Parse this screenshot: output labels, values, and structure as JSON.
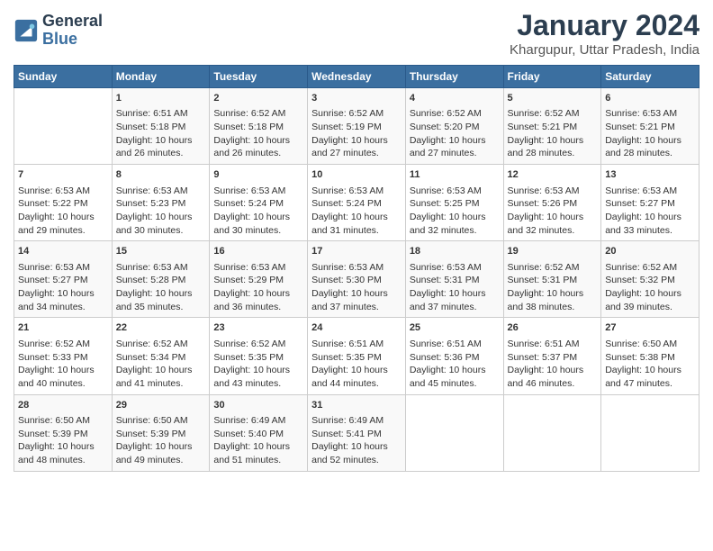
{
  "header": {
    "logo_line1": "General",
    "logo_line2": "Blue",
    "main_title": "January 2024",
    "subtitle": "Khargupur, Uttar Pradesh, India"
  },
  "days_of_week": [
    "Sunday",
    "Monday",
    "Tuesday",
    "Wednesday",
    "Thursday",
    "Friday",
    "Saturday"
  ],
  "weeks": [
    [
      {
        "day": "",
        "info": ""
      },
      {
        "day": "1",
        "info": "Sunrise: 6:51 AM\nSunset: 5:18 PM\nDaylight: 10 hours\nand 26 minutes."
      },
      {
        "day": "2",
        "info": "Sunrise: 6:52 AM\nSunset: 5:18 PM\nDaylight: 10 hours\nand 26 minutes."
      },
      {
        "day": "3",
        "info": "Sunrise: 6:52 AM\nSunset: 5:19 PM\nDaylight: 10 hours\nand 27 minutes."
      },
      {
        "day": "4",
        "info": "Sunrise: 6:52 AM\nSunset: 5:20 PM\nDaylight: 10 hours\nand 27 minutes."
      },
      {
        "day": "5",
        "info": "Sunrise: 6:52 AM\nSunset: 5:21 PM\nDaylight: 10 hours\nand 28 minutes."
      },
      {
        "day": "6",
        "info": "Sunrise: 6:53 AM\nSunset: 5:21 PM\nDaylight: 10 hours\nand 28 minutes."
      }
    ],
    [
      {
        "day": "7",
        "info": "Sunrise: 6:53 AM\nSunset: 5:22 PM\nDaylight: 10 hours\nand 29 minutes."
      },
      {
        "day": "8",
        "info": "Sunrise: 6:53 AM\nSunset: 5:23 PM\nDaylight: 10 hours\nand 30 minutes."
      },
      {
        "day": "9",
        "info": "Sunrise: 6:53 AM\nSunset: 5:24 PM\nDaylight: 10 hours\nand 30 minutes."
      },
      {
        "day": "10",
        "info": "Sunrise: 6:53 AM\nSunset: 5:24 PM\nDaylight: 10 hours\nand 31 minutes."
      },
      {
        "day": "11",
        "info": "Sunrise: 6:53 AM\nSunset: 5:25 PM\nDaylight: 10 hours\nand 32 minutes."
      },
      {
        "day": "12",
        "info": "Sunrise: 6:53 AM\nSunset: 5:26 PM\nDaylight: 10 hours\nand 32 minutes."
      },
      {
        "day": "13",
        "info": "Sunrise: 6:53 AM\nSunset: 5:27 PM\nDaylight: 10 hours\nand 33 minutes."
      }
    ],
    [
      {
        "day": "14",
        "info": "Sunrise: 6:53 AM\nSunset: 5:27 PM\nDaylight: 10 hours\nand 34 minutes."
      },
      {
        "day": "15",
        "info": "Sunrise: 6:53 AM\nSunset: 5:28 PM\nDaylight: 10 hours\nand 35 minutes."
      },
      {
        "day": "16",
        "info": "Sunrise: 6:53 AM\nSunset: 5:29 PM\nDaylight: 10 hours\nand 36 minutes."
      },
      {
        "day": "17",
        "info": "Sunrise: 6:53 AM\nSunset: 5:30 PM\nDaylight: 10 hours\nand 37 minutes."
      },
      {
        "day": "18",
        "info": "Sunrise: 6:53 AM\nSunset: 5:31 PM\nDaylight: 10 hours\nand 37 minutes."
      },
      {
        "day": "19",
        "info": "Sunrise: 6:52 AM\nSunset: 5:31 PM\nDaylight: 10 hours\nand 38 minutes."
      },
      {
        "day": "20",
        "info": "Sunrise: 6:52 AM\nSunset: 5:32 PM\nDaylight: 10 hours\nand 39 minutes."
      }
    ],
    [
      {
        "day": "21",
        "info": "Sunrise: 6:52 AM\nSunset: 5:33 PM\nDaylight: 10 hours\nand 40 minutes."
      },
      {
        "day": "22",
        "info": "Sunrise: 6:52 AM\nSunset: 5:34 PM\nDaylight: 10 hours\nand 41 minutes."
      },
      {
        "day": "23",
        "info": "Sunrise: 6:52 AM\nSunset: 5:35 PM\nDaylight: 10 hours\nand 43 minutes."
      },
      {
        "day": "24",
        "info": "Sunrise: 6:51 AM\nSunset: 5:35 PM\nDaylight: 10 hours\nand 44 minutes."
      },
      {
        "day": "25",
        "info": "Sunrise: 6:51 AM\nSunset: 5:36 PM\nDaylight: 10 hours\nand 45 minutes."
      },
      {
        "day": "26",
        "info": "Sunrise: 6:51 AM\nSunset: 5:37 PM\nDaylight: 10 hours\nand 46 minutes."
      },
      {
        "day": "27",
        "info": "Sunrise: 6:50 AM\nSunset: 5:38 PM\nDaylight: 10 hours\nand 47 minutes."
      }
    ],
    [
      {
        "day": "28",
        "info": "Sunrise: 6:50 AM\nSunset: 5:39 PM\nDaylight: 10 hours\nand 48 minutes."
      },
      {
        "day": "29",
        "info": "Sunrise: 6:50 AM\nSunset: 5:39 PM\nDaylight: 10 hours\nand 49 minutes."
      },
      {
        "day": "30",
        "info": "Sunrise: 6:49 AM\nSunset: 5:40 PM\nDaylight: 10 hours\nand 51 minutes."
      },
      {
        "day": "31",
        "info": "Sunrise: 6:49 AM\nSunset: 5:41 PM\nDaylight: 10 hours\nand 52 minutes."
      },
      {
        "day": "",
        "info": ""
      },
      {
        "day": "",
        "info": ""
      },
      {
        "day": "",
        "info": ""
      }
    ]
  ]
}
